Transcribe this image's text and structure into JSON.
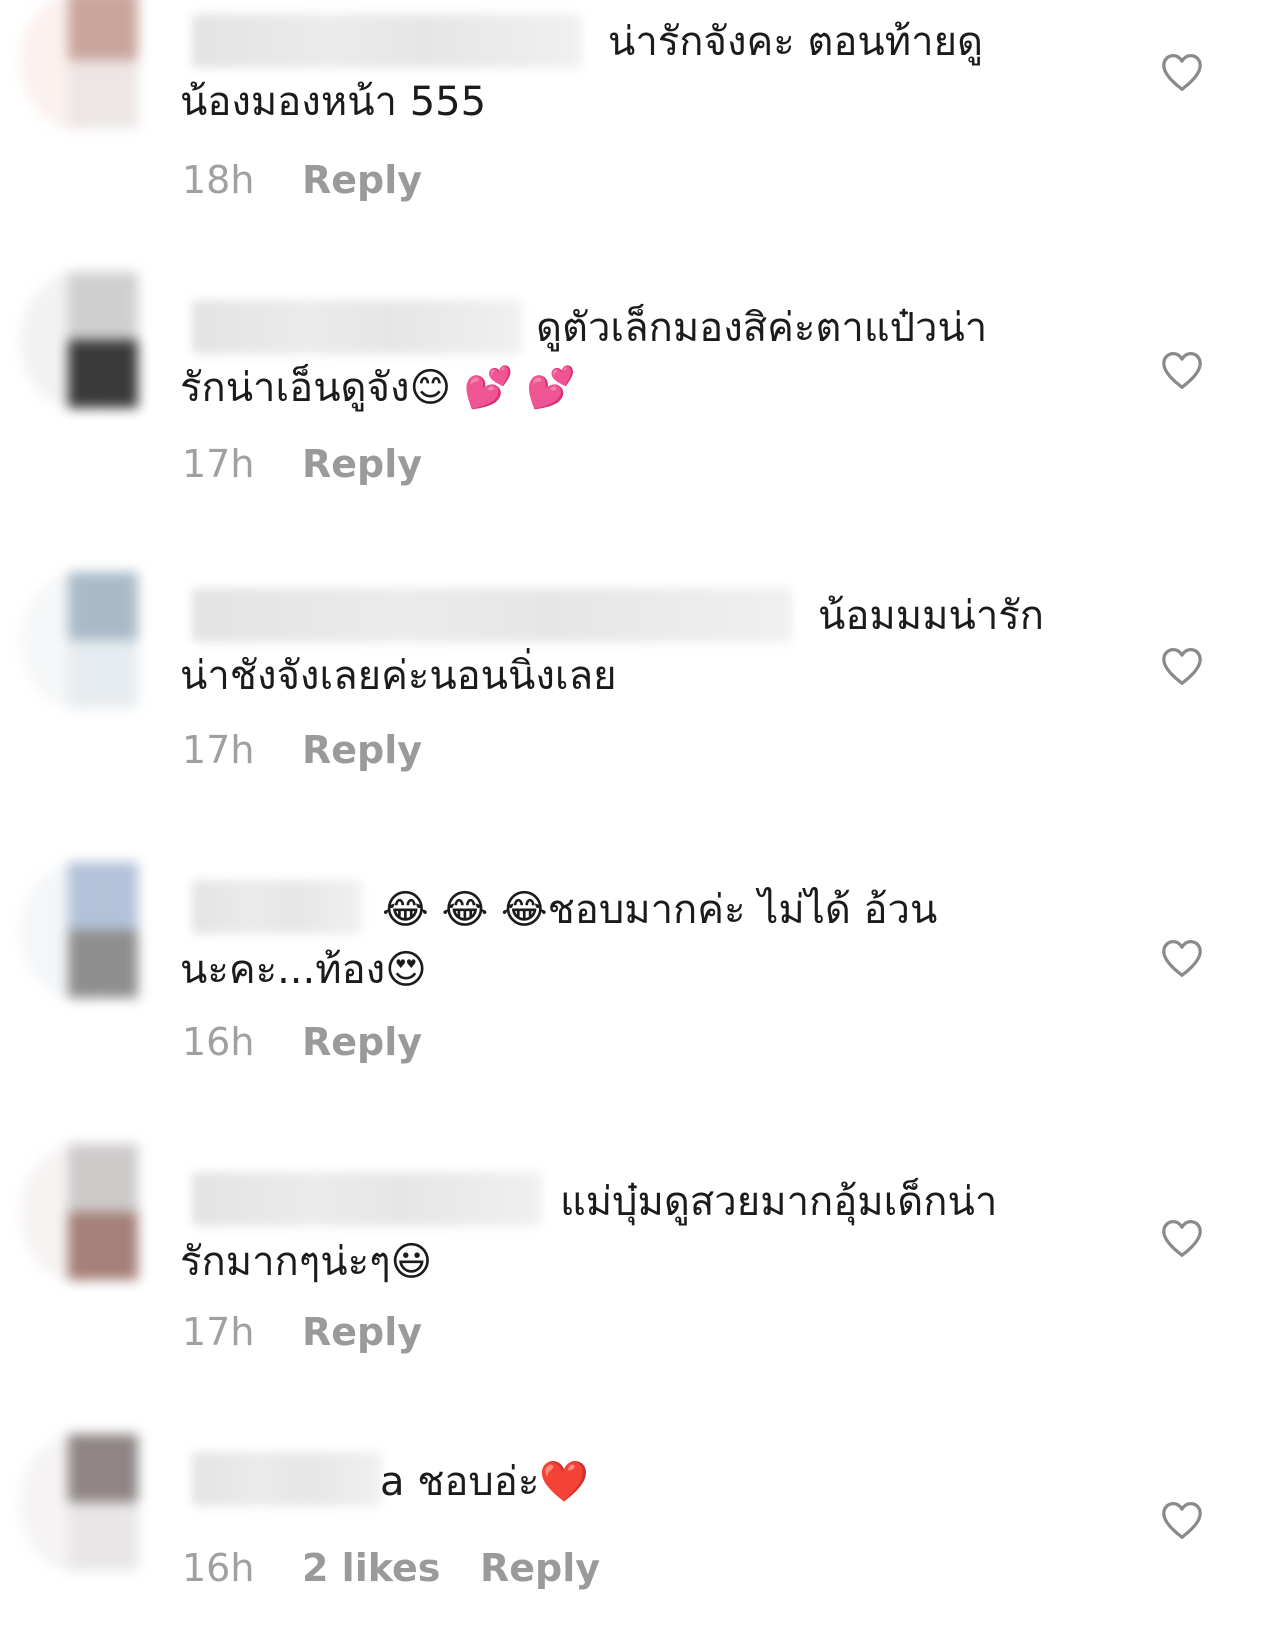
{
  "comments": [
    {
      "line1": "น่ารักจังคะ ตอนท้ายดู",
      "line2": "น้องมองหน้า 555",
      "time": "18h",
      "likes": "",
      "reply": "Reply",
      "avatar_colors": [
        "#c9a59c",
        "#ece6e4"
      ]
    },
    {
      "line1": "ดูตัวเล็กมองสิค่ะตาแป๋วน่า",
      "line2": "รักน่าเอ็นดูจัง😊 💕 💕",
      "time": "17h",
      "likes": "",
      "reply": "Reply",
      "avatar_colors": [
        "#cfcfcf",
        "#3a3a3a"
      ]
    },
    {
      "line1": "น้อมมมน่ารัก",
      "line2": "น่าชังจังเลยค่ะนอนนิ่งเลย",
      "time": "17h",
      "likes": "",
      "reply": "Reply",
      "avatar_colors": [
        "#a9bac9",
        "#e6ecef"
      ]
    },
    {
      "line1": "😂 😂 😂ชอบมากค่ะ ไม่ได้ อ้วน",
      "line2": "นะคะ...ท้อง😍",
      "time": "16h",
      "likes": "",
      "reply": "Reply",
      "avatar_colors": [
        "#b2c2d9",
        "#8e8e8e"
      ]
    },
    {
      "line1": "แม่บุ๋มดูสวยมากอุ้มเด็กน่า",
      "line2": "รักมากๆน่ะๆ😃",
      "time": "17h",
      "likes": "",
      "reply": "Reply",
      "avatar_colors": [
        "#cdcaca",
        "#a58078"
      ]
    },
    {
      "line1": "a ชอบอ่ะ❤️",
      "line2": "",
      "time": "16h",
      "likes": "2 likes",
      "reply": "Reply",
      "avatar_colors": [
        "#8f8585",
        "#e8e6e6"
      ]
    }
  ],
  "icons": {
    "like": "heart-outline-icon"
  },
  "colors": {
    "text": "#1b1b1b",
    "meta": "#9a9a9a",
    "icon_stroke": "#8a8a8a"
  }
}
